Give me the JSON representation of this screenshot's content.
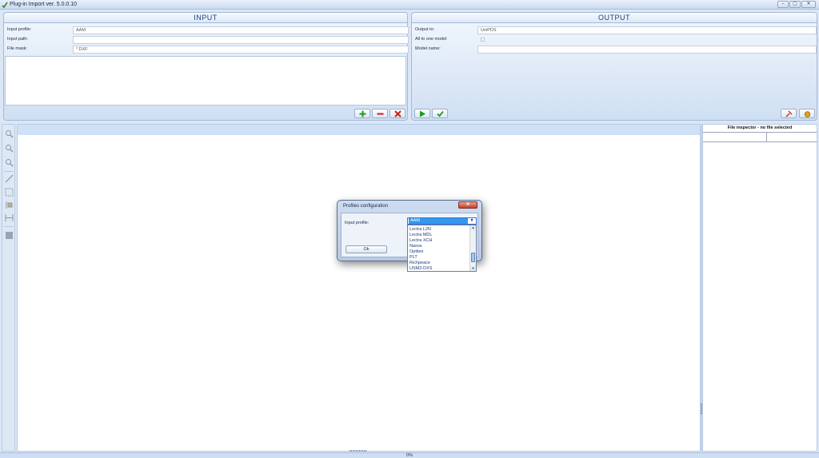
{
  "window": {
    "title": "Plug-in Import ver. 5.0.0.10"
  },
  "input_panel": {
    "header": "INPUT",
    "profile_label": "Input profile:",
    "profile_value": "AAM",
    "path_label": "Input path:",
    "path_value": "",
    "mask_label": "File mask:",
    "mask_value": "*.DXF"
  },
  "output_panel": {
    "header": "OUTPUT",
    "output_to_label": "Output to:",
    "output_to_value": "UniPDS",
    "all_to_one_label": "All to one model",
    "model_name_label": "Model name:",
    "model_name_value": ""
  },
  "inspector": {
    "header": "File inspector - no file selected"
  },
  "status": {
    "progress_text": "0%"
  },
  "dialog": {
    "title": "Profiles configuration",
    "close_glyph": "✕",
    "input_profile_label": "Input profile:",
    "selected_profile": "AAM",
    "ok_label": "Ok",
    "options": [
      "Lectra L2N",
      "Lectra MDL",
      "Lectra XCH",
      "Naxos",
      "Optitex",
      "PLT",
      "Richpeace",
      "USM2-DXS"
    ]
  },
  "colors": {
    "accent": "#3398f0",
    "panel_header_text": "#1d3f7a",
    "canvas_strip": "#cfe1f7",
    "close_red": "#c2402a"
  }
}
